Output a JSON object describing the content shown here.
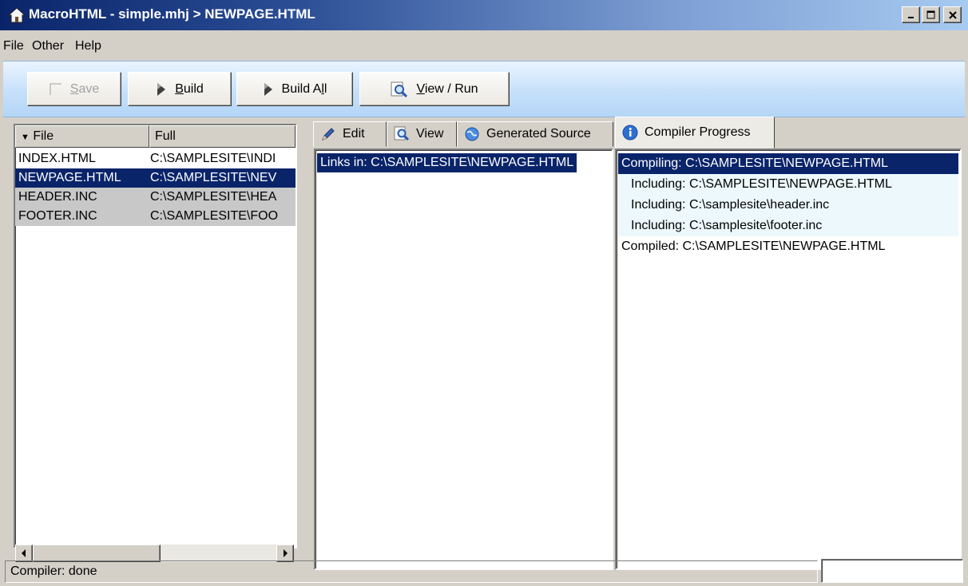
{
  "window": {
    "title": "MacroHTML - simple.mhj > NEWPAGE.HTML",
    "controls": {
      "minimize": "_",
      "maximize": "□",
      "close": "×"
    }
  },
  "menu": [
    "File",
    "Other",
    "Help"
  ],
  "toolbar": {
    "save": {
      "pre": "",
      "key": "S",
      "post": "ave"
    },
    "build": {
      "pre": "",
      "key": "B",
      "post": "uild"
    },
    "build_all": {
      "pre": "Build A",
      "key": "l",
      "post": "l"
    },
    "view_run": {
      "pre": "",
      "key": "V",
      "post": "iew / Run"
    }
  },
  "file_list": {
    "columns": {
      "file": "File",
      "full": "Full",
      "sort_indicator": "▼"
    },
    "rows": [
      {
        "file": "INDEX.HTML",
        "full": "C:\\SAMPLESITE\\INDI"
      },
      {
        "file": "NEWPAGE.HTML",
        "full": "C:\\SAMPLESITE\\NEV"
      },
      {
        "file": "HEADER.INC",
        "full": "C:\\SAMPLESITE\\HEA"
      },
      {
        "file": "FOOTER.INC",
        "full": "C:\\SAMPLESITE\\FOO"
      }
    ]
  },
  "tabs": [
    "Edit",
    "View",
    "Generated Source",
    "Compiler Progress"
  ],
  "links": {
    "row": "Links in: C:\\SAMPLESITE\\NEWPAGE.HTML"
  },
  "progress": [
    "Compiling: C:\\SAMPLESITE\\NEWPAGE.HTML",
    "Including: C:\\SAMPLESITE\\NEWPAGE.HTML",
    "Including: C:\\samplesite\\header.inc",
    "Including: C:\\samplesite\\footer.inc",
    "Compiled: C:\\SAMPLESITE\\NEWPAGE.HTML"
  ],
  "status": {
    "text": "Compiler: done"
  },
  "colors": {
    "selection": "#0a246a",
    "title_start": "#0a246a",
    "title_end": "#a6caf0",
    "toolbar": "#c6e0fa",
    "face": "#d4d0c8"
  },
  "icons": [
    "home-icon",
    "checkbox-icon",
    "play-icon",
    "magnifier-icon",
    "pencil-icon",
    "globe-icon",
    "info-icon"
  ]
}
